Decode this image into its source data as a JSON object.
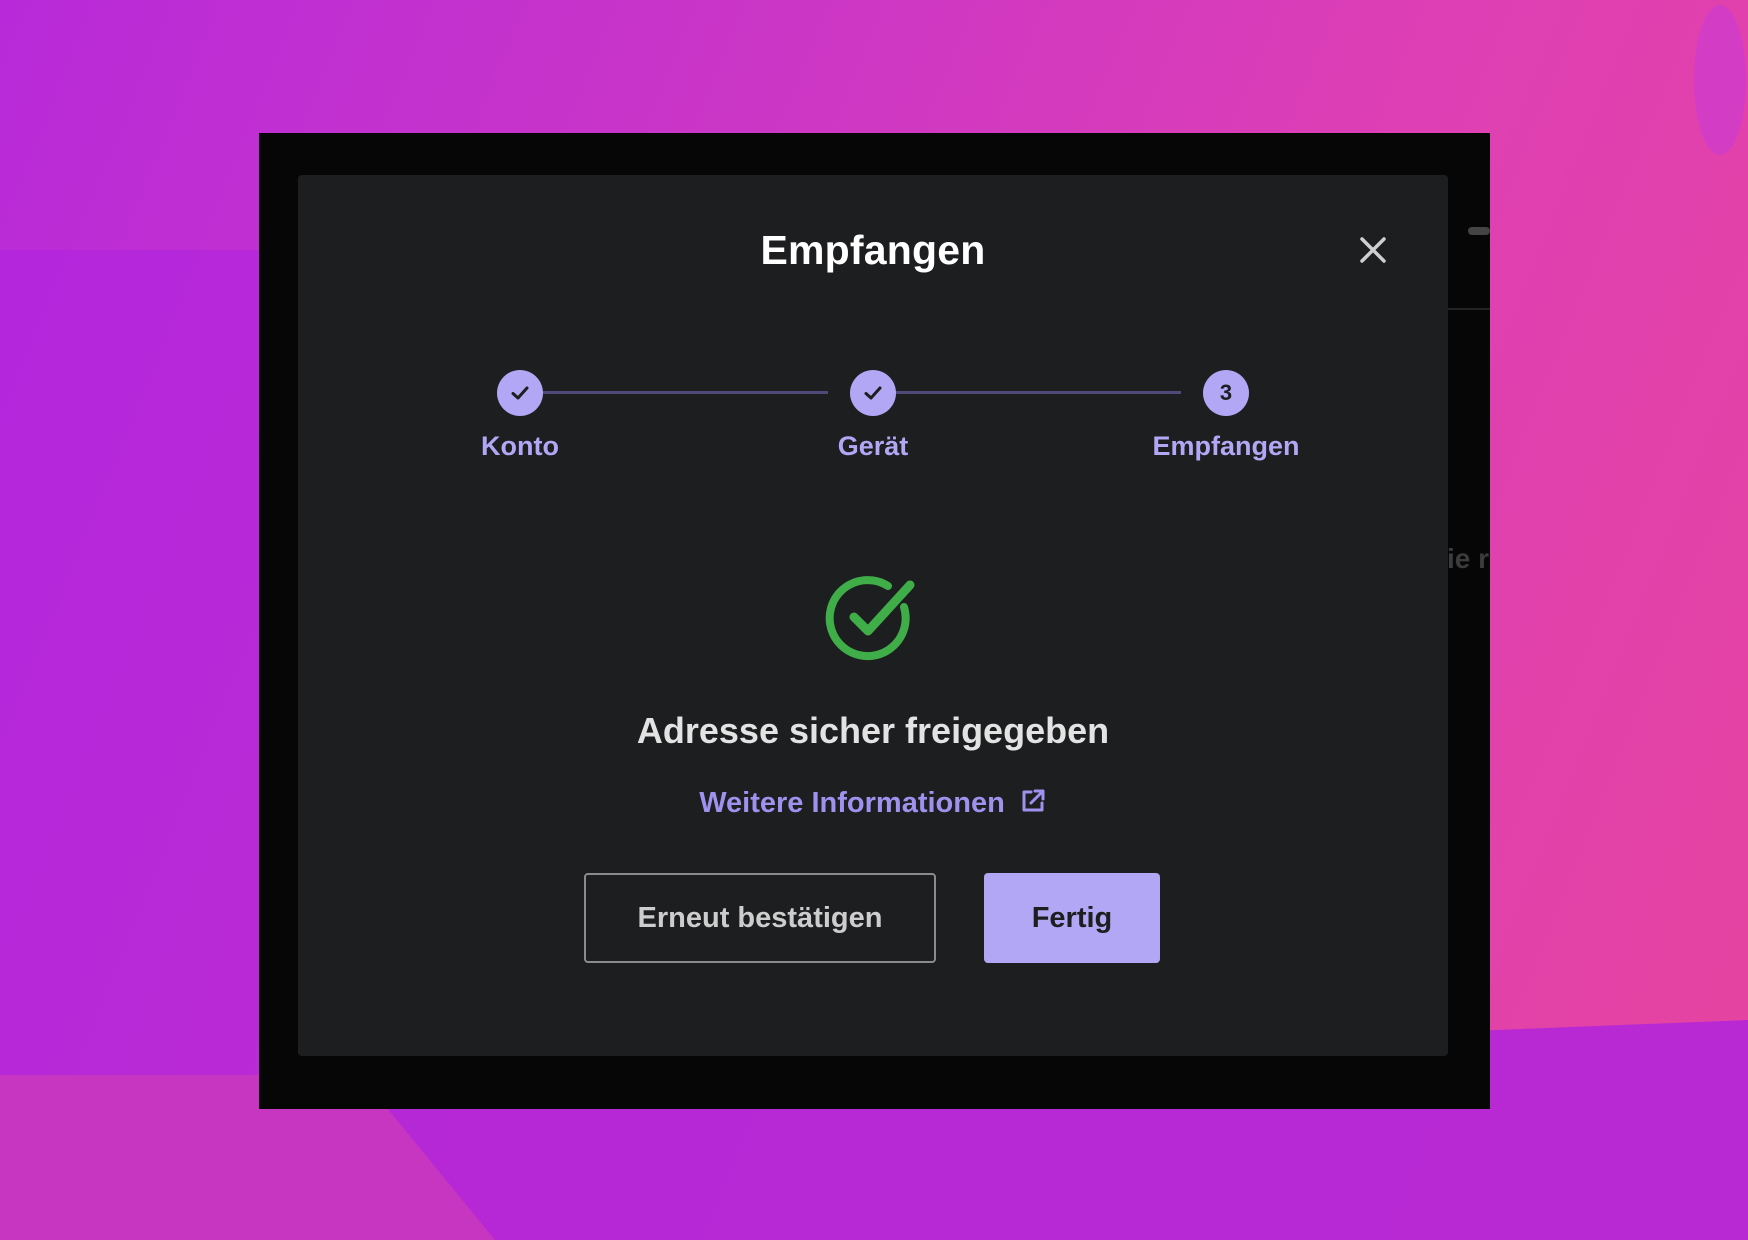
{
  "modal": {
    "title": "Empfangen",
    "close_icon": "close-icon"
  },
  "stepper": {
    "steps": [
      {
        "label": "Konto",
        "state": "completed",
        "indicator": "check-icon"
      },
      {
        "label": "Gerät",
        "state": "completed",
        "indicator": "check-icon"
      },
      {
        "label": "Empfangen",
        "state": "current",
        "number": "3"
      }
    ]
  },
  "status": {
    "icon": "check-circle-icon",
    "message": "Adresse sicher freigegeben"
  },
  "link": {
    "label": "Weitere Informationen",
    "icon": "external-link-icon"
  },
  "actions": {
    "secondary_label": "Erneut bestätigen",
    "primary_label": "Fertig"
  },
  "background": {
    "partial_text": "ie r"
  },
  "colors": {
    "accent": "#b1a7f5",
    "link": "#9f92ee",
    "success": "#3fae49",
    "modal_bg": "#1d1e20",
    "window_bg": "#060606"
  }
}
